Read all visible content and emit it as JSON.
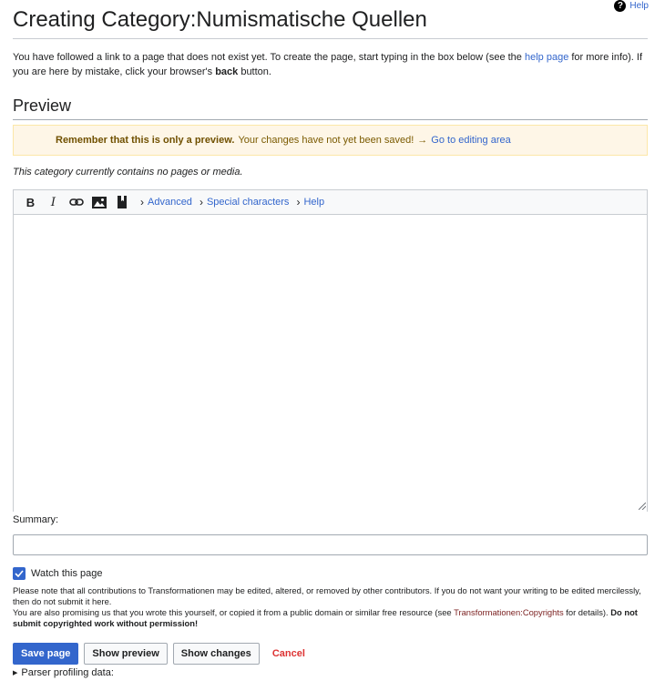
{
  "help": {
    "label": "Help"
  },
  "page_title": "Creating Category:Numismatische Quellen",
  "intro": {
    "before_link": "You have followed a link to a page that does not exist yet. To create the page, start typing in the box below (see the ",
    "link": "help page",
    "after_link": " for more info). If you are here by mistake, click your browser's ",
    "bold": "back",
    "end": " button."
  },
  "preview_heading": "Preview",
  "warning": {
    "bold": "Remember that this is only a preview.",
    "text": "Your changes have not yet been saved!",
    "arrow": "→",
    "link": "Go to editing area"
  },
  "empty_category": "This category currently contains no pages or media.",
  "toolbar": {
    "bold": "B",
    "italic": "I",
    "sections": [
      "Advanced",
      "Special characters",
      "Help"
    ]
  },
  "editor": {
    "content": ""
  },
  "summary": {
    "label": "Summary:",
    "value": ""
  },
  "watch": {
    "label": "Watch this page",
    "checked": true
  },
  "notice": {
    "line1": "Please note that all contributions to Transformationen may be edited, altered, or removed by other contributors. If you do not want your writing to be edited mercilessly, then do not submit it here.",
    "line2_before": "You are also promising us that you wrote this yourself, or copied it from a public domain or similar free resource (see ",
    "line2_link": "Transformationen:Copyrights",
    "line2_after": " for details). ",
    "line2_bold": "Do not submit copyrighted work without permission!"
  },
  "buttons": {
    "save": "Save page",
    "preview": "Show preview",
    "changes": "Show changes",
    "cancel": "Cancel"
  },
  "parser": {
    "label": "Parser profiling data:"
  },
  "colors": {
    "accent": "#3366cc",
    "warning_bg": "#fef6e7",
    "cancel": "#d33333"
  }
}
